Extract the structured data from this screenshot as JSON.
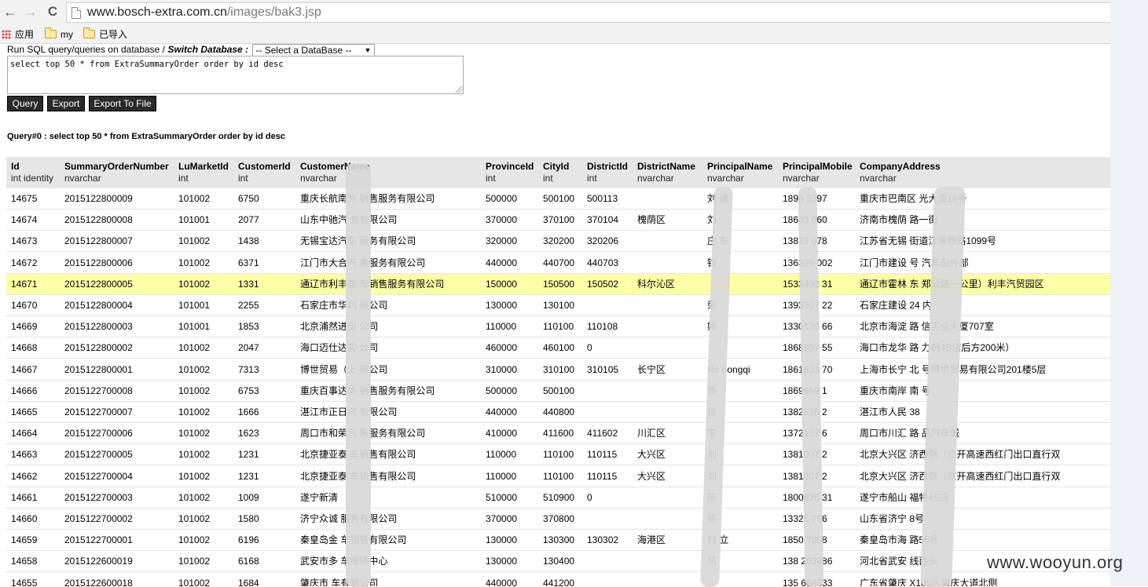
{
  "browser": {
    "back_glyph": "←",
    "forward_glyph": "→",
    "reload_glyph": "C",
    "url_domain": "www.bosch-extra.com.cn",
    "url_path": "/images/bak3.jsp",
    "bookmarks": [
      {
        "label": "应用",
        "icon": "apps-grid-icon"
      },
      {
        "label": "my",
        "icon": "folder-icon"
      },
      {
        "label": "已导入",
        "icon": "folder-icon"
      }
    ]
  },
  "tool": {
    "intro_text": "Run SQL query/queries on database / ",
    "switch_label": "Switch Database :",
    "select_value": "-- Select a DataBase --",
    "select_caret": "▼",
    "sql_text": "select top 50 * from ExtraSummaryOrder order by id desc",
    "buttons": {
      "query": "Query",
      "export": "Export",
      "export_file": "Export To File"
    },
    "query_title": "Query#0 : select top 50 * from ExtraSummaryOrder order by id desc"
  },
  "table": {
    "columns": [
      {
        "name": "Id",
        "type": "int identity"
      },
      {
        "name": "SummaryOrderNumber",
        "type": "nvarchar"
      },
      {
        "name": "LuMarketId",
        "type": "int"
      },
      {
        "name": "CustomerId",
        "type": "int"
      },
      {
        "name": "CustomerName",
        "type": "nvarchar"
      },
      {
        "name": "ProvinceId",
        "type": "int"
      },
      {
        "name": "CityId",
        "type": "int"
      },
      {
        "name": "DistrictId",
        "type": "int"
      },
      {
        "name": "DistrictName",
        "type": "nvarchar"
      },
      {
        "name": "PrincipalName",
        "type": "nvarchar"
      },
      {
        "name": "PrincipalMobile",
        "type": "nvarchar"
      },
      {
        "name": "CompanyAddress",
        "type": "nvarchar"
      }
    ],
    "rows": [
      [
        "14675",
        "2015122800009",
        "101002",
        "6750",
        "重庆长航南方 销售服务有限公司",
        "500000",
        "500100",
        "500113",
        "",
        "刘 建",
        "1898 3397",
        "重庆市巴南区 光大道18号"
      ],
      [
        "14674",
        "2015122800008",
        "101001",
        "2077",
        "山东中驰汽 务有限公司",
        "370000",
        "370100",
        "370104",
        "槐荫区",
        "刘",
        "18663 060",
        "济南市槐荫 路一街"
      ],
      [
        "14673",
        "2015122800007",
        "101002",
        "1438",
        "无锡宝达汽车 服务有限公司",
        "320000",
        "320200",
        "320206",
        "",
        "庄 东",
        "13813 078",
        "江苏省无锡 街道江海西路1099号"
      ],
      [
        "14672",
        "2015122800006",
        "101002",
        "6371",
        "江门市大合汽 售服务有限公司",
        "440000",
        "440700",
        "440703",
        "",
        "钧",
        "136329 002",
        "江门市建设 号 汽车配件部"
      ],
      [
        "14671",
        "2015122800005",
        "101002",
        "1331",
        "通辽市利丰泰 车销售服务有限公司",
        "150000",
        "150500",
        "150502",
        "科尔沁区",
        "",
        "1533492 31",
        "通辽市霍林 东 郑公路一公里）利丰汽贸园区"
      ],
      [
        "14670",
        "2015122800004",
        "101001",
        "2255",
        "石家庄市华利 限公司",
        "130000",
        "130100",
        "",
        "",
        "荣",
        "1393307 22",
        "石家庄建设 24 内"
      ],
      [
        "14669",
        "2015122800003",
        "101001",
        "1853",
        "北京浦然进出 公司",
        "110000",
        "110100",
        "110108",
        "",
        "娜",
        "1330139 66",
        "北京市海淀 路 信实业大厦707室"
      ],
      [
        "14668",
        "2015122800002",
        "101002",
        "2047",
        "海口迈仕达实 公司",
        "460000",
        "460100",
        "0",
        "",
        "",
        "1868987 55",
        "海口市龙华 路 力帆4S店后方200米）"
      ],
      [
        "14667",
        "2015122800001",
        "101002",
        "7313",
        "博世贸易（上 限公司",
        "310000",
        "310100",
        "310105",
        "长宁区",
        "Re hongqi",
        "1861633 70",
        "上海市长宁 北 号博世贸易有限公司201楼5层"
      ],
      [
        "14666",
        "2015122700008",
        "101002",
        "6753",
        "重庆百事达华 销售服务有限公司",
        "500000",
        "500100",
        "",
        "",
        "杨",
        "1869669 1",
        "重庆市南岸 南 号"
      ],
      [
        "14665",
        "2015122700007",
        "101002",
        "1666",
        "湛江市正日汽 有限公司",
        "440000",
        "440800",
        "",
        "",
        "徐",
        "1382826 2",
        "湛江市人民 38"
      ],
      [
        "14664",
        "2015122700006",
        "101002",
        "1623",
        "周口市和荣汽 售服务有限公司",
        "410000",
        "411600",
        "411602",
        "川汇区",
        "李",
        "1372137 6",
        "周口市川汇 路 品汽车城"
      ],
      [
        "14663",
        "2015122700005",
        "101002",
        "1231",
        "北京捷亚泰 车销售有限公司",
        "110000",
        "110100",
        "110115",
        "大兴区",
        "刘",
        "1381007 2",
        "北京大兴区 济西侧（京开高速西红门出口直行双"
      ],
      [
        "14662",
        "2015122700004",
        "101002",
        "1231",
        "北京捷亚泰 车销售有限公司",
        "110000",
        "110100",
        "110115",
        "大兴区",
        "刘",
        "1381007 2",
        "北京大兴区 济西侧（京开高速西红门出口直行双"
      ],
      [
        "14661",
        "2015122700003",
        "101002",
        "1009",
        "遂宁新清 ",
        "510000",
        "510900",
        "0",
        "",
        "陈",
        "1800826 31",
        "遂宁市船山 福特4S店"
      ],
      [
        "14660",
        "2015122700002",
        "101002",
        "1580",
        "济宁众诚 服务有限公司",
        "370000",
        "370800",
        "",
        "",
        "陈",
        "13325 766",
        "山东省济宁 8号"
      ],
      [
        "14659",
        "2015122700001",
        "101002",
        "6196",
        "秦皇岛金 车销售有限公司",
        "130000",
        "130300",
        "130302",
        "海港区",
        "付 立",
        "1850 7058",
        "秦皇岛市海 路55号"
      ],
      [
        "14658",
        "2015122600019",
        "101002",
        "6168",
        "武安市多 车维修中心",
        "130000",
        "130400",
        "",
        "",
        "风",
        "138 203986",
        "河北省武安 线西头"
      ],
      [
        "14655",
        "2015122600018",
        "101002",
        "1684",
        "肇庆市 车有限公司",
        "440000",
        "441200",
        "",
        "",
        "",
        "135 668833",
        "广东省肇庆 X105区肇庆大道北侧"
      ]
    ]
  },
  "watermark": "www.wooyun.org",
  "colors": {
    "highlight_row": "#ffffa8",
    "header_bg": "#e6e6e6",
    "button_bg": "#2a2a2a",
    "blur": "#d8d8d8"
  }
}
